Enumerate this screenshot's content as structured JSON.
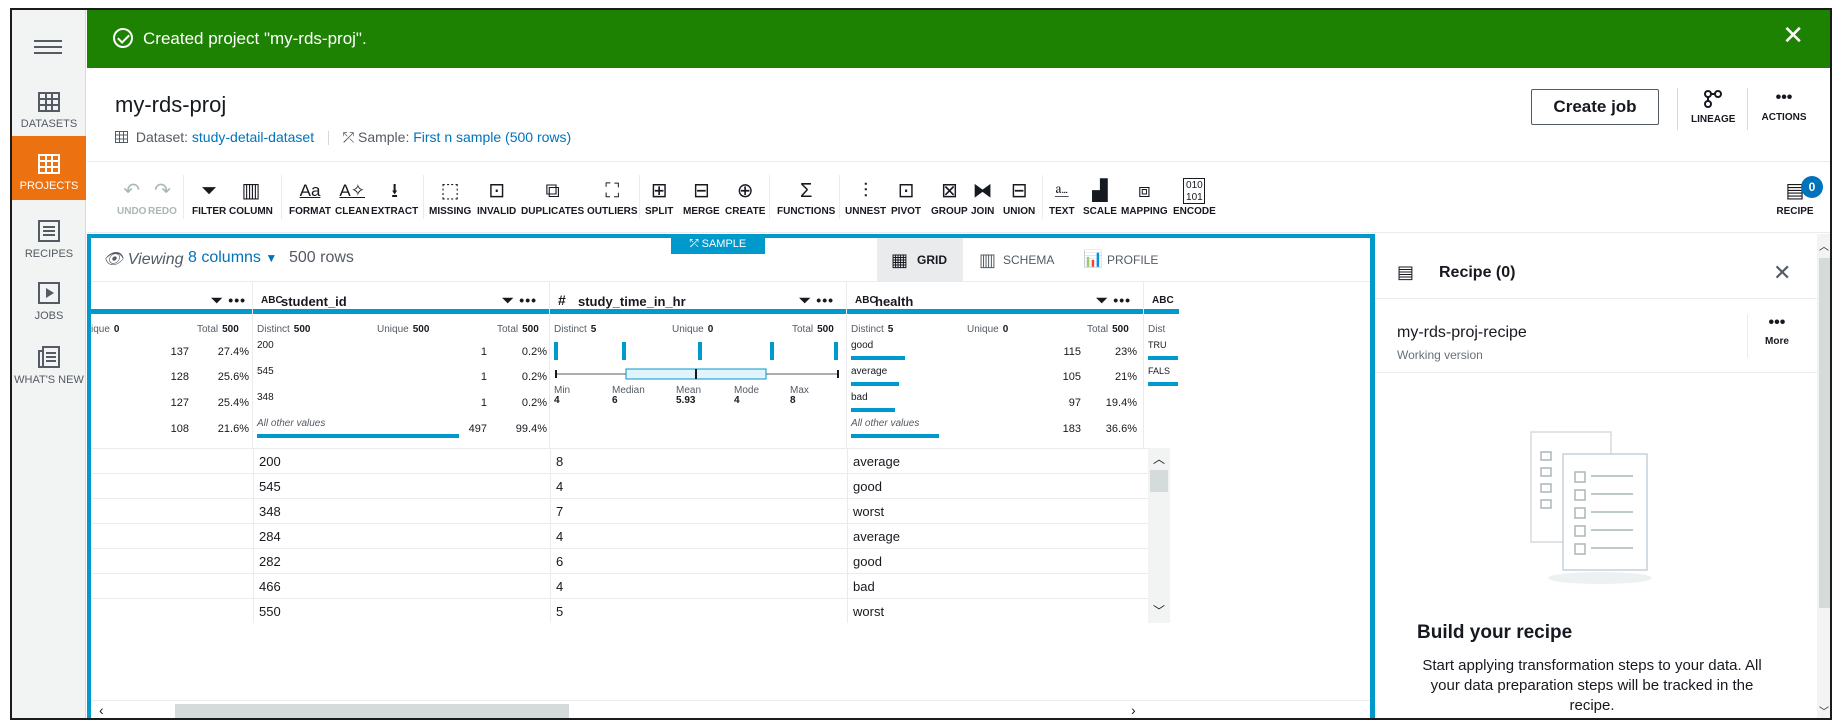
{
  "banner": {
    "message": "Created project \"my-rds-proj\"."
  },
  "nav": {
    "items": [
      {
        "label": "DATASETS"
      },
      {
        "label": "PROJECTS"
      },
      {
        "label": "RECIPES"
      },
      {
        "label": "JOBS"
      },
      {
        "label": "WHAT'S NEW"
      }
    ]
  },
  "project": {
    "title": "my-rds-proj",
    "dataset_label": "Dataset:",
    "dataset_name": "study-detail-dataset",
    "sample_label": "Sample:",
    "sample_name": "First n sample (500 rows)",
    "create_job": "Create job",
    "lineage": "LINEAGE",
    "actions": "ACTIONS"
  },
  "toolbar": {
    "undo": "UNDO",
    "redo": "REDO",
    "filter": "FILTER",
    "column": "COLUMN",
    "format": "FORMAT",
    "clean": "CLEAN",
    "extract": "EXTRACT",
    "missing": "MISSING",
    "invalid": "INVALID",
    "duplicates": "DUPLICATES",
    "outliers": "OUTLIERS",
    "split": "SPLIT",
    "merge": "MERGE",
    "create": "CREATE",
    "functions": "FUNCTIONS",
    "unnest": "UNNEST",
    "pivot": "PIVOT",
    "group": "GROUP",
    "join": "JOIN",
    "union": "UNION",
    "text": "TEXT",
    "scale": "SCALE",
    "mapping": "MAPPING",
    "encode": "ENCODE",
    "recipe": "RECIPE",
    "recipe_count": "0"
  },
  "grid": {
    "sample_tag": "SAMPLE",
    "viewing": "Viewing",
    "columns": "8 columns",
    "rows": "500 rows",
    "tabs": {
      "grid": "GRID",
      "schema": "SCHEMA",
      "profile": "PROFILE"
    },
    "col0": {
      "unique_label": "ique",
      "unique": "0",
      "total_label": "Total",
      "total": "500",
      "rows": [
        {
          "count": "137",
          "pct": "27.4%"
        },
        {
          "count": "128",
          "pct": "25.6%"
        },
        {
          "count": "127",
          "pct": "25.4%"
        },
        {
          "count": "108",
          "pct": "21.6%"
        }
      ]
    },
    "student_id": {
      "type": "ABC",
      "name": "student_id",
      "distinct_label": "Distinct",
      "distinct": "500",
      "unique_label": "Unique",
      "unique": "500",
      "total_label": "Total",
      "total": "500",
      "values": [
        {
          "label": "200",
          "count": "1",
          "pct": "0.2%"
        },
        {
          "label": "545",
          "count": "1",
          "pct": "0.2%"
        },
        {
          "label": "348",
          "count": "1",
          "pct": "0.2%"
        },
        {
          "label": "All other values",
          "count": "497",
          "pct": "99.4%"
        }
      ]
    },
    "study_time": {
      "type": "#",
      "name": "study_time_in_hr",
      "distinct_label": "Distinct",
      "distinct": "5",
      "unique_label": "Unique",
      "unique": "0",
      "total_label": "Total",
      "total": "500",
      "min_label": "Min",
      "min": "4",
      "median_label": "Median",
      "median": "6",
      "mean_label": "Mean",
      "mean": "5.93",
      "mode_label": "Mode",
      "mode": "4",
      "max_label": "Max",
      "max": "8"
    },
    "health": {
      "type": "ABC",
      "name": "health",
      "distinct_label": "Distinct",
      "distinct": "5",
      "unique_label": "Unique",
      "unique": "0",
      "total_label": "Total",
      "total": "500",
      "values": [
        {
          "label": "good",
          "count": "115",
          "pct": "23%"
        },
        {
          "label": "average",
          "count": "105",
          "pct": "21%"
        },
        {
          "label": "bad",
          "count": "97",
          "pct": "19.4%"
        },
        {
          "label": "All other values",
          "count": "183",
          "pct": "36.6%"
        }
      ]
    },
    "col4": {
      "type": "ABC",
      "stat": "Dist",
      "v1": "TRU",
      "v2": "FALS"
    },
    "table": [
      [
        "200",
        "8",
        "average"
      ],
      [
        "545",
        "4",
        "good"
      ],
      [
        "348",
        "7",
        "worst"
      ],
      [
        "284",
        "4",
        "average"
      ],
      [
        "282",
        "6",
        "good"
      ],
      [
        "466",
        "4",
        "bad"
      ],
      [
        "550",
        "5",
        "worst"
      ]
    ]
  },
  "recipe": {
    "title": "Recipe (0)",
    "name": "my-rds-proj-recipe",
    "version": "Working version",
    "more": "More",
    "build_title": "Build your recipe",
    "build_desc": "Start applying transformation steps to your data. All your data preparation steps will be tracked in the recipe."
  }
}
